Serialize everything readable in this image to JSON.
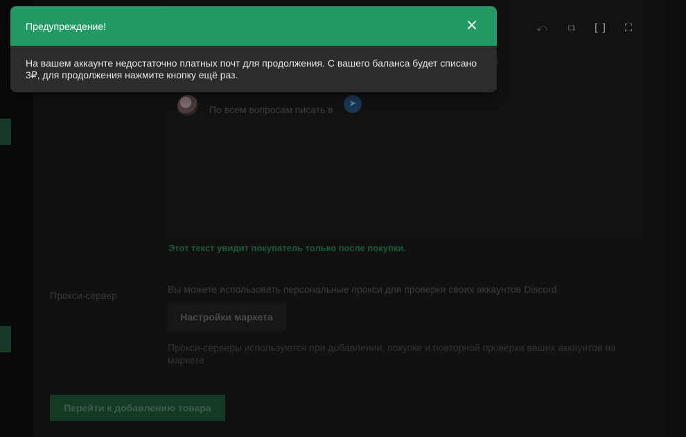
{
  "toast": {
    "title": "Предупреждение!",
    "close_icon": "×",
    "message": "На вашем аккаунте недостаточно платных почт для продолжения. С вашего баланса будет списано 3₽, для продолжения нажмите кнопку ещё раз."
  },
  "editor": {
    "toolbar_icons": [
      "undo-icon",
      "external-link-icon",
      "brackets-icon",
      "fullscreen-icon"
    ],
    "toolbar_glyphs": [
      "⤺",
      "⧉",
      "[ ]",
      "⛶"
    ],
    "contact_text": "По всем вопросам писать в",
    "telegram_glyph": "➤"
  },
  "hint": "Этот текст увидит покупатель только после покупки.",
  "proxy": {
    "label": "Прокси-сервер",
    "description": "Вы можете использовать персональные прокси для проверки своих аккаунтов Discord",
    "settings_button": "Настройки маркета",
    "note": "Прокси-серверы используются при добавлении, покупке и повторной проверки ваших аккаунтов на маркете"
  },
  "submit_button": "Перейти к добавлению товара",
  "colors": {
    "toast_header": "#229a63",
    "toast_body": "#2c2c2c",
    "overlay_bg": "#0e0e0e"
  }
}
